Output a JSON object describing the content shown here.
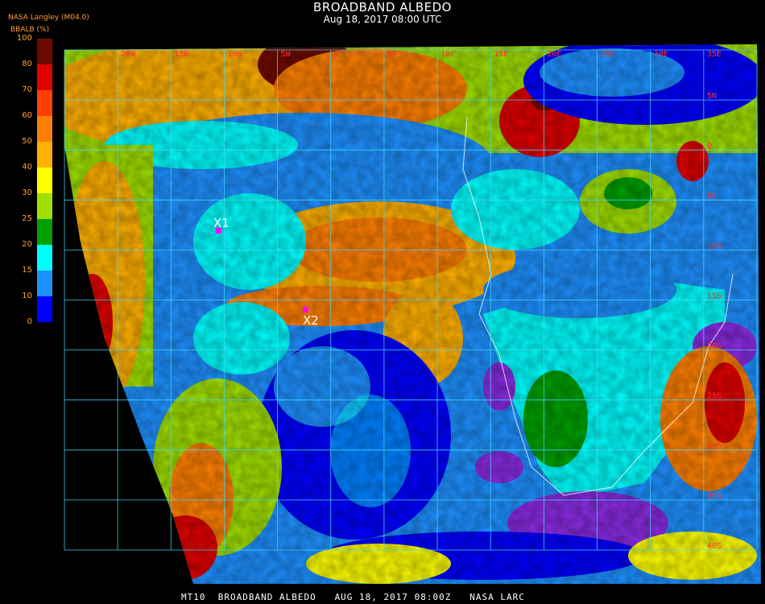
{
  "header": {
    "title": "BROADBAND ALBEDO",
    "subtitle": "Aug 18, 2017 08:00 UTC",
    "source": "NASA Langley (M04.0)",
    "unit": "BBALB (%)"
  },
  "colorbar": {
    "ticks": [
      "100",
      "80",
      "70",
      "60",
      "50",
      "40",
      "30",
      "25",
      "20",
      "15",
      "10",
      "0"
    ],
    "colors": [
      "#6e0a00",
      "#e00000",
      "#ff4000",
      "#ff8000",
      "#ffb000",
      "#ffff00",
      "#a0e000",
      "#00a000",
      "#00ffff",
      "#1e90ff",
      "#0000ff",
      "#8a2be2"
    ]
  },
  "grid": {
    "lon_labels": [
      "20W",
      "15W",
      "10W",
      "5W",
      "0",
      "5E",
      "10E",
      "15E",
      "20E",
      "25E",
      "30E",
      "35E"
    ],
    "lat_labels": [
      "5N",
      "0",
      "5S",
      "10S",
      "15S",
      "20S",
      "25S",
      "30S",
      "35S",
      "40S"
    ]
  },
  "markers": [
    {
      "label": "X1",
      "color": "#ff00ff"
    },
    {
      "label": "X2",
      "color": "#ff00ff"
    }
  ],
  "footer": "MT10  BROADBAND ALBEDO   AUG 18, 2017 08:00Z   NASA LARC"
}
